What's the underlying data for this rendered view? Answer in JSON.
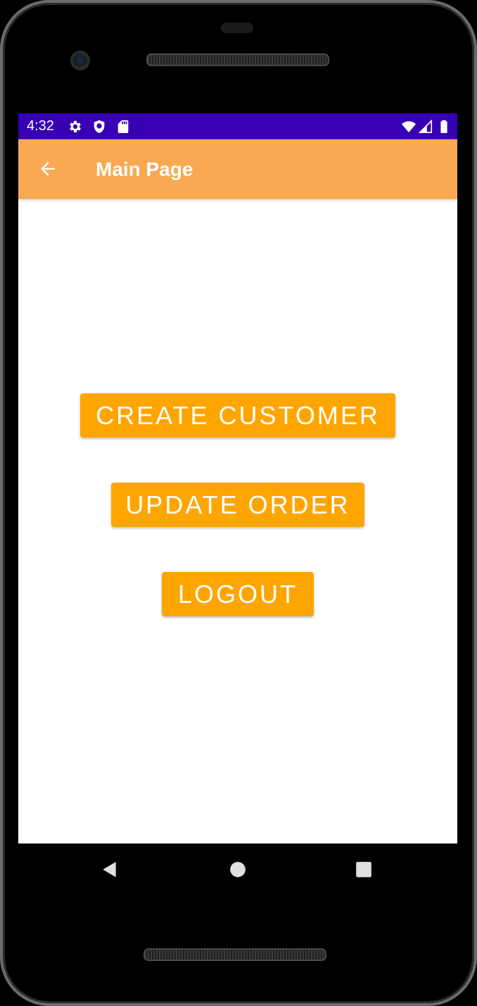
{
  "status_bar": {
    "time": "4:32",
    "left_icons": [
      "settings-icon",
      "shield-icon",
      "sd-card-icon"
    ],
    "right_icons": [
      "wifi-icon",
      "signal-icon",
      "battery-icon"
    ],
    "color": "#3700b3"
  },
  "app_bar": {
    "title": "Main Page",
    "back_icon": "arrow-back-icon",
    "color": "#f8a952"
  },
  "main": {
    "buttons": [
      {
        "label": "CREATE CUSTOMER"
      },
      {
        "label": "UPDATE ORDER"
      },
      {
        "label": "LOGOUT"
      }
    ],
    "button_color": "#ffa500"
  },
  "nav_bar": {
    "icons": [
      "back-triangle-icon",
      "home-circle-icon",
      "recents-square-icon"
    ]
  }
}
